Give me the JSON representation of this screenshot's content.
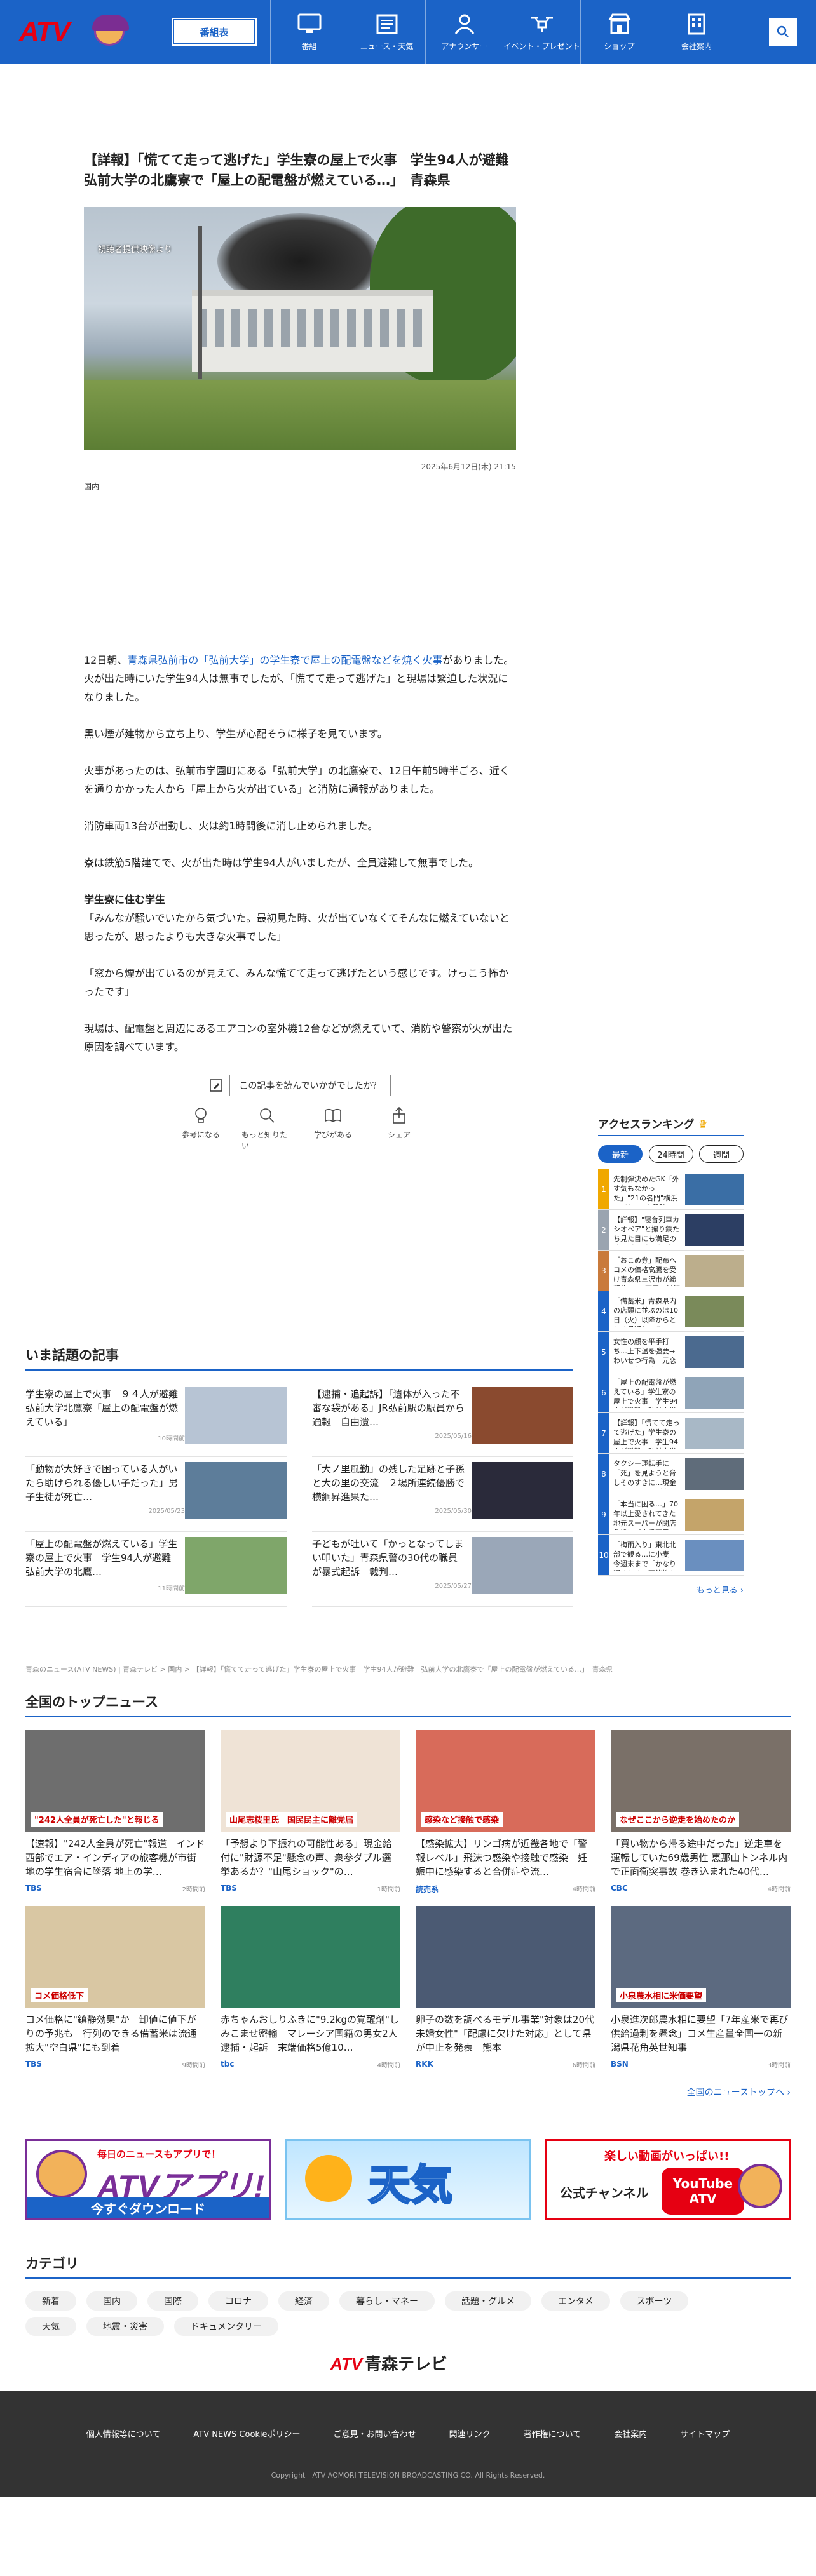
{
  "header": {
    "logo_text": "ATV",
    "program_button": "番組表",
    "nav": [
      {
        "label": "番組",
        "icon": "tv-icon"
      },
      {
        "label": "ニュース・天気",
        "icon": "newspaper-icon"
      },
      {
        "label": "アナウンサー",
        "icon": "announcer-icon"
      },
      {
        "label": "イベント・プレゼント",
        "icon": "drone-icon"
      },
      {
        "label": "ショップ",
        "icon": "shop-icon"
      },
      {
        "label": "会社案内",
        "icon": "building-icon"
      }
    ]
  },
  "article": {
    "title": "【詳報】「慌てて走って逃げた」学生寮の屋上で火事　学生94人が避難　弘前大学の北鷹寮で「屋上の配電盤が燃えている…」　青森県",
    "image_caption": "視聴者提供映像より",
    "date": "2025年6月12日(木) 21:15",
    "category": "国内",
    "lead_pre": "12日朝、",
    "lead_link": "青森県弘前市の「弘前大学」の学生寮で屋上の配電盤などを焼く火事",
    "lead_post": "がありました。火が出た時にいた学生94人は無事でしたが、「慌てて走って逃げた」と現場は緊迫した状況になりました。",
    "paragraphs": [
      "黒い煙が建物から立ち上り、学生が心配そうに様子を見ています。",
      "火事があったのは、弘前市学園町にある「弘前大学」の北鷹寮で、12日午前5時半ごろ、近くを通りかかった人から「屋上から火が出ている」と消防に通報がありました。",
      "消防車両13台が出動し、火は約1時間後に消し止められました。",
      "寮は鉄筋5階建てで、火が出た時は学生94人がいましたが、全員避難して無事でした。"
    ],
    "subhead": "学生寮に住む学生",
    "quote1": "「みんなが騒いでいたから気づいた。最初見た時、火が出ていなくてそんなに燃えていないと思ったが、思ったよりも大きな火事でした」",
    "quote2": "「窓から煙が出ているのが見えて、みんな慌てて走って逃げたという感じです。けっこう怖かったです」",
    "closing": "現場は、配電盤と周辺にあるエアコンの室外機12台などが燃えていて、消防や警察が火が出た原因を調べています。"
  },
  "reaction": {
    "question": "この記事を読んでいかがでしたか？",
    "items": [
      "参考になる",
      "もっと知りたい",
      "学びがある",
      "シェア"
    ]
  },
  "ranking": {
    "title": "アクセスランキング",
    "tabs": [
      "最新",
      "24時間",
      "週間"
    ],
    "items": [
      {
        "n": "1",
        "t": "先制弾決めたGK「外す気もなかった」\"21の名門\"横浜Fマリノスを撃破の「ライ…",
        "c": "#f0a800"
      },
      {
        "n": "2",
        "t": "【詳報】\"寝台列車カシオペア\"と撮り鉄たち見た目にも満足の旅 JR東日本　新幹線…",
        "c": "#9aa4b0"
      },
      {
        "n": "3",
        "t": "「おこめ券」配布へ　コメの価格高騰を受け青森県三沢市が総額約5000万円の対策事業…",
        "c": "#c97a3b"
      },
      {
        "n": "4",
        "t": "「備蓄米」青森県内の店頭に並ぶのは10日（火）以降からとなる見通し　その後…",
        "c": "#1b63c7"
      },
      {
        "n": "5",
        "t": "女性の顔を平手打ち…上下温を強要→わいせつ行為　元恋人の暴行・強要・不同意性…",
        "c": "#1b63c7"
      },
      {
        "n": "6",
        "t": "「屋上の配電盤が燃えている」学生寮の屋上で火事　学生94人が避難　弘前大学の北鷹…",
        "c": "#1b63c7"
      },
      {
        "n": "7",
        "t": "【詳報】「慌てて走って逃げた」学生寮の屋上で火事　学生94人が避難　弘前大学の北…",
        "c": "#1b63c7"
      },
      {
        "n": "8",
        "t": "タクシー運転手に「死」を見ようと脅しそのすきに…現金とハンドバッグ奪った容疑の…",
        "c": "#1b63c7"
      },
      {
        "n": "9",
        "t": "「本当に困る…」70年以上愛されてきた地元スーパーが閉店危機に「人手不足」 求…",
        "c": "#1b63c7"
      },
      {
        "n": "10",
        "t": "「梅雨入り」東北北部で観る…に小麦　今週末まで「かなり遅くなる」可能性も",
        "c": "#1b63c7"
      }
    ],
    "more": "もっと見る ›"
  },
  "hot": {
    "title": "いま話題の記事",
    "items": [
      {
        "t": "学生寮の屋上で火事　９４人が避難　弘前大学北鷹寮「屋上の配電盤が燃えている」",
        "d": "10時間前"
      },
      {
        "t": "【逮捕・追起訴】「遺体が入った不審な袋がある」JR弘前駅の駅員から通報　自由遺…",
        "d": "2025/05/16"
      },
      {
        "t": "「動物が大好きで困っている人がいたら助けられる優しい子だった」男子生徒が死亡…",
        "d": "2025/05/23"
      },
      {
        "t": "「大ノ里風勤」の残した足跡と子孫と大の里の交流　２場所連続優勝で横綱昇進果た…",
        "d": "2025/05/30"
      },
      {
        "t": "「屋上の配電盤が燃えている」学生寮の屋上で火事　学生94人が避難　弘前大学の北鷹…",
        "d": "11時間前"
      },
      {
        "t": "子どもが吐いて「かっとなってしまい叩いた」青森県警の30代の職員が暴式起訴　裁判…",
        "d": "2025/05/27"
      }
    ]
  },
  "breadcrumb": "青森のニュース(ATV NEWS) | 青森テレビ > 国内 > 【詳報】「慌てて走って逃げた」学生寮の屋上で火事　学生94人が避難　弘前大学の北鷹寮で「屋上の配電盤が燃えている…」　青森県",
  "topnews": {
    "title": "全国のトップニュース",
    "items": [
      {
        "t": "【速報】\"242人全員が死亡\"報道　インド西部でエア・インディアの旅客機が市街地の学生宿舎に墜落 地上の学…",
        "src": "TBS",
        "ago": "2時間前",
        "img": "#6e6e6e",
        "overlay": "\"242人全員が死亡した\"と報じる"
      },
      {
        "t": "「予想より下振れの可能性ある」現金給付に\"財源不足\"懸念の声、衆参ダブル選挙あるか？\"山尾ショック\"の…",
        "src": "TBS",
        "ago": "1時間前",
        "img": "#efe3d6",
        "overlay": "山尾志桜里氏　国民民主に離党届"
      },
      {
        "t": "【感染拡大】リンゴ病が近畿各地で「警報レベル」飛沫つ感染や接触で感染　妊娠中に感染すると合併症や流…",
        "src": "読売系",
        "ago": "4時間前",
        "img": "#d86b5a",
        "overlay": "感染など接触で感染"
      },
      {
        "t": "「買い物から帰る途中だった」逆走車を運転していた69歳男性 恵那山トンネル内で正面衝突事故 巻き込まれた40代…",
        "src": "CBC",
        "ago": "4時間前",
        "img": "#7a7068",
        "overlay": "なぜここから逆走を始めたのか"
      },
      {
        "t": "コメ価格に\"鎮静効果\"か　卸値に値下がりの予兆も　行列のできる備蓄米は流通拡大\"空白県\"にも到着",
        "src": "TBS",
        "ago": "9時間前",
        "img": "#d9c7a3",
        "overlay": "コメ価格低下"
      },
      {
        "t": "赤ちゃんおしりふきに\"9.2kgの覚醒剤\"しみこませ密輸　マレーシア国籍の男女2人逮捕・起訴　末端価格5億10…",
        "src": "tbc",
        "ago": "4時間前",
        "img": "#2f7f5f",
        "overlay": ""
      },
      {
        "t": "卵子の数を調べるモデル事業\"対象は20代未婚女性\"「配慮に欠けた対応」として県が中止を発表　熊本",
        "src": "RKK",
        "ago": "6時間前",
        "img": "#4b5a73",
        "overlay": ""
      },
      {
        "t": "小泉進次郎農水相に要望「7年産米で再び供給過剰を懸念」コメ生産量全国一の新潟県花角英世知事",
        "src": "BSN",
        "ago": "3時間前",
        "img": "#5c6a80",
        "overlay": "小泉農水相に米価要望"
      }
    ],
    "all_link": "全国のニューストップへ ›"
  },
  "banners": {
    "app_top": "毎日のニュースもアプリで！",
    "app_big": "ATVアプリ!",
    "app_bar": "今すぐダウンロード",
    "weather": "天気",
    "yt_top": "楽しい動画がいっぱい!!",
    "yt_ch": "公式チャンネル",
    "yt_logo1": "YouTube",
    "yt_logo2": "ATV"
  },
  "categories": {
    "title": "カテゴリ",
    "items": [
      "新着",
      "国内",
      "国際",
      "コロナ",
      "経済",
      "暮らし・マネー",
      "話題・グルメ",
      "エンタメ",
      "スポーツ",
      "天気",
      "地震・災害",
      "ドキュメンタリー"
    ]
  },
  "footer_logo": {
    "mark": "ATV",
    "name": "青森テレビ"
  },
  "footer": {
    "links": [
      "個人情報等について",
      "ATV NEWS Cookieポリシー",
      "ご意見・お問い合わせ",
      "関連リンク",
      "著作権について",
      "会社案内",
      "サイトマップ"
    ],
    "copyright": "Copyright　ATV AOMORI TELEVISION BROADCASTING CO. All Rights Reserved."
  },
  "colors": {
    "brand": "#1b63c7",
    "accent": "#e60012"
  }
}
